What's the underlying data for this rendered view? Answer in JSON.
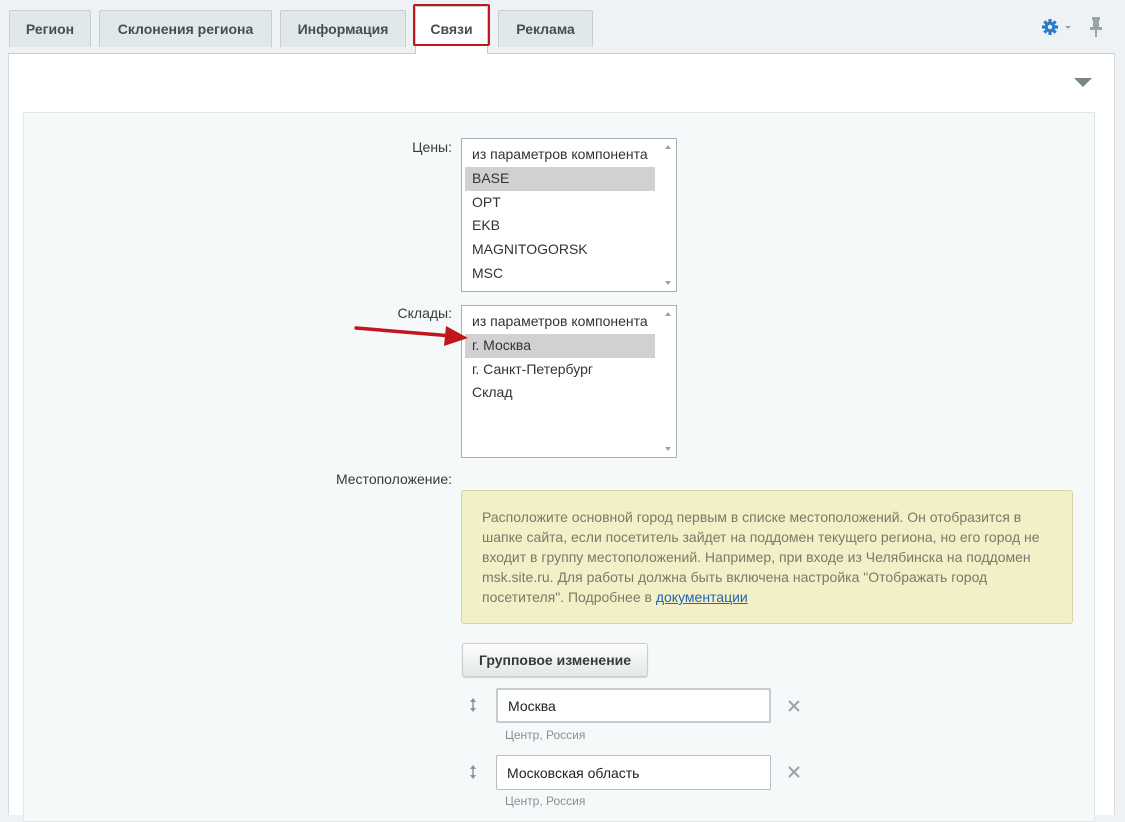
{
  "tabs": [
    {
      "label": "Регион",
      "active": false
    },
    {
      "label": "Склонения региона",
      "active": false
    },
    {
      "label": "Информация",
      "active": false
    },
    {
      "label": "Связи",
      "active": true
    },
    {
      "label": "Реклама",
      "active": false
    }
  ],
  "toolbar": {
    "settings_icon": "gear-icon",
    "pin_icon": "pin-icon"
  },
  "form": {
    "prices": {
      "label": "Цены:",
      "options": [
        "из параметров компонента",
        "BASE",
        "OPT",
        "EKB",
        "MAGNITOGORSK",
        "MSC"
      ],
      "selected": "BASE"
    },
    "warehouses": {
      "label": "Склады:",
      "options": [
        "из параметров компонента",
        "г. Москва",
        "г. Санкт-Петербург",
        "Склад"
      ],
      "selected": "г. Москва"
    },
    "location": {
      "label": "Местоположение:",
      "note_text": "Расположите основной город первым в списке местоположений. Он отобразится в шапке сайта, если посетитель зайдет на поддомен текущего региона, но его город не входит в группу местоположений. Например, при входе из Челябинска на поддомен msk.site.ru. Для работы должна быть включена настройка \"Отображать город посетителя\". Подробнее в",
      "note_link": "документации",
      "group_button": "Групповое изменение",
      "items": [
        {
          "value": "Москва",
          "sub": "Центр, Россия"
        },
        {
          "value": "Московская область",
          "sub": "Центр, Россия"
        }
      ]
    }
  },
  "colors": {
    "highlight": "#c0161c",
    "gear": "#2b7bc4",
    "note_bg": "#f3efc6"
  }
}
